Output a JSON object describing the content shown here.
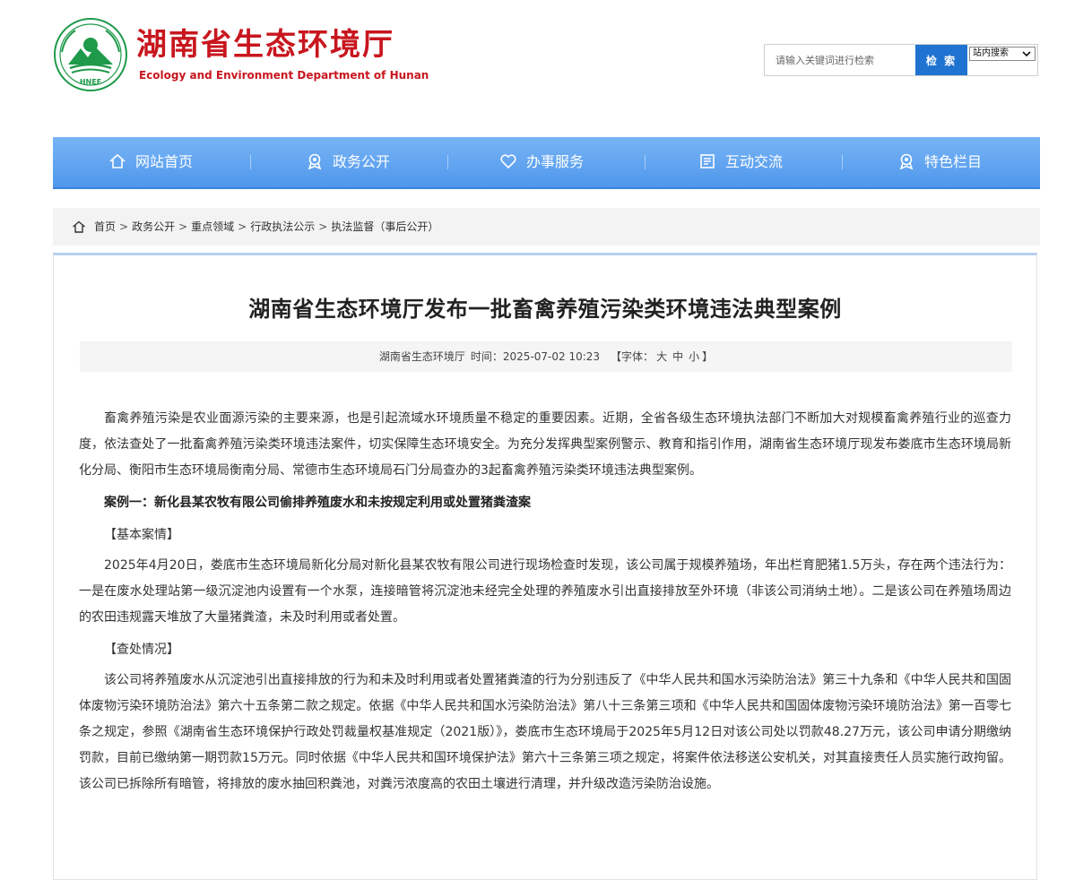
{
  "header": {
    "title": "湖南省生态环境厅",
    "subtitle": "Ecology and Environment Department of Hunan",
    "emblem_text": "HNEE",
    "colors": {
      "brand_red": "#c8161e",
      "brand_green": "#1e9a4a"
    }
  },
  "search": {
    "placeholder": "请输入关键词进行检索",
    "button_label": "检 索",
    "scope_label": "站内搜索"
  },
  "nav": {
    "items": [
      {
        "label": "网站首页",
        "icon": "home-icon"
      },
      {
        "label": "政务公开",
        "icon": "badge-icon"
      },
      {
        "label": "办事服务",
        "icon": "heart-icon"
      },
      {
        "label": "互动交流",
        "icon": "document-icon"
      },
      {
        "label": "特色栏目",
        "icon": "badge-icon"
      }
    ],
    "colors": {
      "bar": "#5a9ff0"
    }
  },
  "breadcrumb": {
    "items": [
      "首页",
      "政务公开",
      "重点领域",
      "行政执法公示",
      "执法监督（事后公开）"
    ],
    "separator": ">"
  },
  "article": {
    "title": "湖南省生态环境厅发布一批畜禽养殖污染类环境违法典型案例",
    "meta": {
      "source": "湖南省生态环境厅",
      "time_label": "时间：",
      "time": "2025-07-02 10:23",
      "font_label": "【字体：",
      "font_large": "大",
      "font_medium": "中",
      "font_small": "小",
      "font_end": "】"
    },
    "intro": "畜禽养殖污染是农业面源污染的主要来源，也是引起流域水环境质量不稳定的重要因素。近期，全省各级生态环境执法部门不断加大对规模畜禽养殖行业的巡查力度，依法查处了一批畜禽养殖污染类环境违法案件，切实保障生态环境安全。为充分发挥典型案例警示、教育和指引作用，湖南省生态环境厅现发布娄底市生态环境局新化分局、衡阳市生态环境局衡南分局、常德市生态环境局石门分局查办的3起畜禽养殖污染类环境违法典型案例。",
    "case1_title": "案例一：新化县某农牧有限公司偷排养殖废水和未按规定利用或处置猪粪渣案",
    "basic_label": "【基本案情】",
    "basic_text": "2025年4月20日，娄底市生态环境局新化分局对新化县某农牧有限公司进行现场检查时发现，该公司属于规模养殖场，年出栏育肥猪1.5万头，存在两个违法行为：一是在废水处理站第一级沉淀池内设置有一个水泵，连接暗管将沉淀池未经完全处理的养殖废水引出直接排放至外环境（非该公司消纳土地）。二是该公司在养殖场周边的农田违规露天堆放了大量猪粪渣，未及时利用或者处置。",
    "handling_label": "【查处情况】",
    "handling_text": "该公司将养殖废水从沉淀池引出直接排放的行为和未及时利用或者处置猪粪渣的行为分别违反了《中华人民共和国水污染防治法》第三十九条和《中华人民共和国固体废物污染环境防治法》第六十五条第二款之规定。依据《中华人民共和国水污染防治法》第八十三条第三项和《中华人民共和国固体废物污染环境防治法》第一百零七条之规定，参照《湖南省生态环境保护行政处罚裁量权基准规定（2021版）》，娄底市生态环境局于2025年5月12日对该公司处以罚款48.27万元，该公司申请分期缴纳罚款，目前已缴纳第一期罚款15万元。同时依据《中华人民共和国环境保护法》第六十三条第三项之规定，将案件依法移送公安机关，对其直接责任人员实施行政拘留。该公司已拆除所有暗管，将排放的废水抽回积粪池，对粪污浓度高的农田土壤进行清理，并升级改造污染防治设施。"
  }
}
